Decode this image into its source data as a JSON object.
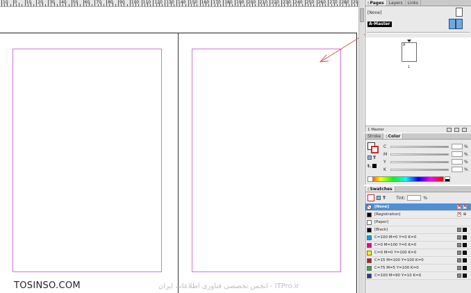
{
  "ruler": {
    "labels": [
      "10",
      "0",
      "10",
      "20",
      "30",
      "40",
      "50",
      "60",
      "70",
      "80",
      "90",
      "100",
      "110",
      "120",
      "130",
      "140",
      "150",
      "160",
      "170",
      "180",
      "190",
      "200",
      "210",
      "220",
      "230",
      "240",
      "250",
      "260",
      "270",
      "280",
      "290"
    ]
  },
  "watermark": {
    "left": "TOSINSO.COM",
    "right": "انجمن تخصصی فناوری اطلاعات ایران - ITPro.ir"
  },
  "pages_panel": {
    "tabs": [
      "Pages",
      "Layers",
      "Links"
    ],
    "none_label": "[None]",
    "master_label": "A-Master",
    "page_thumb_letter": "A",
    "page_number": "1",
    "footer_status": "1 Master"
  },
  "color_panel": {
    "tabs": [
      "Stroke",
      "Color"
    ],
    "channels": [
      "C",
      "M",
      "Y",
      "K"
    ],
    "percent_sign": "%"
  },
  "swatches_panel": {
    "title": "Swatches",
    "tint_label": "Tint:",
    "percent_sign": "%",
    "rows": [
      {
        "name": "[None]",
        "color": "#ffffff",
        "selected": true
      },
      {
        "name": "[Registration]",
        "color": "#000000",
        "selected": false
      },
      {
        "name": "[Paper]",
        "color": "#ffffff",
        "selected": false
      },
      {
        "name": "[Black]",
        "color": "#000000",
        "selected": false
      },
      {
        "name": "C=100 M=0 Y=0 K=0",
        "color": "#00a0e3",
        "selected": false
      },
      {
        "name": "C=0 M=100 Y=0 K=0",
        "color": "#e5007e",
        "selected": false
      },
      {
        "name": "C=0 M=0 Y=100 K=0",
        "color": "#fff100",
        "selected": false
      },
      {
        "name": "C=15 M=100 Y=100 K=0",
        "color": "#c8161d",
        "selected": false
      },
      {
        "name": "C=75 M=5 Y=100 K=0",
        "color": "#3aa935",
        "selected": false
      },
      {
        "name": "C=100 M=90 Y=10 K=0",
        "color": "#2b3990",
        "selected": false
      }
    ]
  },
  "colors": {
    "margin_guide": "#d86ee0",
    "annotation_arrow": "#d94d4d",
    "selection": "#4e8fd6"
  }
}
